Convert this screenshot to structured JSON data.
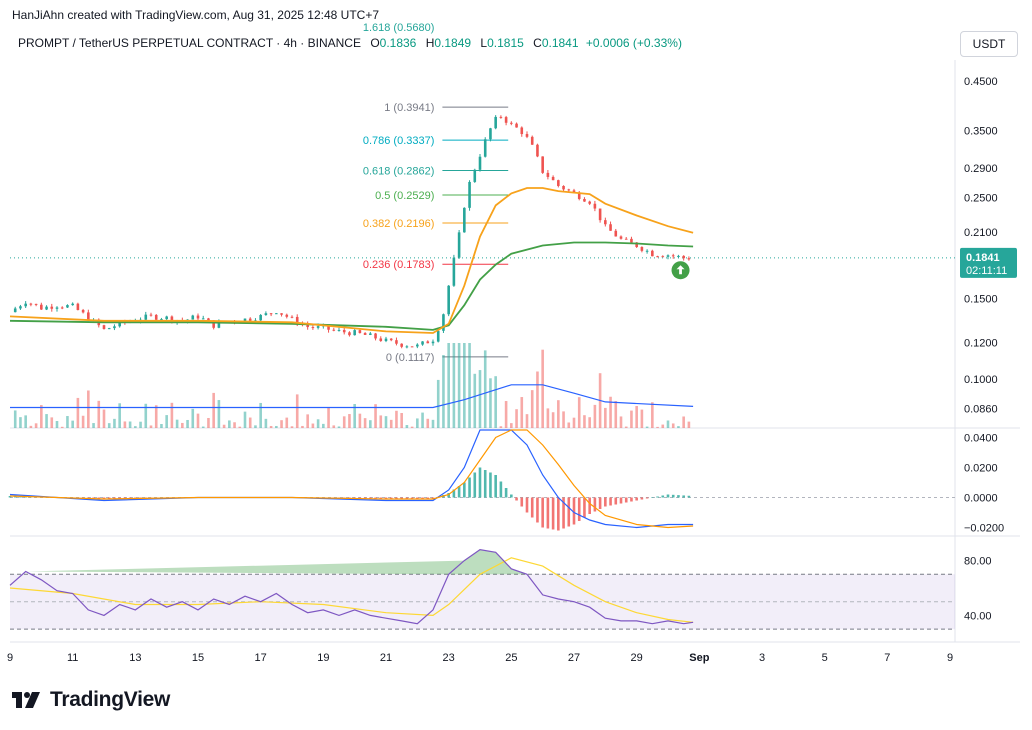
{
  "header": {
    "credit": "HanJiAhn created with TradingView.com, Aug 31, 2025 12:48 UTC+7",
    "symbol": "PROMPT / TetherUS PERPETUAL CONTRACT · 4h · BINANCE",
    "o_label": "O",
    "o_value": "0.1836",
    "h_label": "H",
    "h_value": "0.1849",
    "l_label": "L",
    "l_value": "0.1815",
    "c_label": "C",
    "c_value": "0.1841",
    "change": "+0.0006 (+0.33%)",
    "currency_button": "USDT"
  },
  "brand": {
    "name": "TradingView"
  },
  "colors": {
    "up": "#26a69a",
    "down": "#ef5350",
    "ma_fast": "#f7a21b",
    "ma_slow": "#43a047",
    "macd": "#2962ff",
    "signal": "#ff9800",
    "rsi": "#7e57c2",
    "rsi_ma": "#fdd835"
  },
  "chart_data": {
    "type": "candlestick",
    "timeframe": "4h",
    "y_axis_ticks": [
      "0.4500",
      "0.3500",
      "0.2900",
      "0.2500",
      "0.2100",
      "0.1500",
      "0.1200",
      "0.1000",
      "0.0860"
    ],
    "y_scale": "log",
    "x_axis_ticks": [
      "9",
      "11",
      "13",
      "15",
      "17",
      "19",
      "21",
      "23",
      "25",
      "27",
      "29",
      "Sep",
      "3",
      "5",
      "7",
      "9"
    ],
    "last_price": "0.1841",
    "countdown": "02:11:11",
    "fib_levels": [
      {
        "label": "1 (0.3941)",
        "value": 0.3941,
        "color": "#787b86"
      },
      {
        "label": "0.786 (0.3337)",
        "value": 0.3337,
        "color": "#00acc1"
      },
      {
        "label": "0.618 (0.2862)",
        "value": 0.2862,
        "color": "#26a69a"
      },
      {
        "label": "0.5 (0.2529)",
        "value": 0.2529,
        "color": "#4caf50"
      },
      {
        "label": "0.382 (0.2196)",
        "value": 0.2196,
        "color": "#f7a21b"
      },
      {
        "label": "0.236 (0.1783)",
        "value": 0.1783,
        "color": "#f23645"
      },
      {
        "label": "0 (0.1117)",
        "value": 0.1117,
        "color": "#787b86"
      }
    ],
    "fib_partial_label": "1.618 (0.5680)",
    "price_path": [
      [
        9,
        0.14
      ],
      [
        9.5,
        0.148
      ],
      [
        10,
        0.143
      ],
      [
        10.5,
        0.145
      ],
      [
        11,
        0.144
      ],
      [
        11.5,
        0.136
      ],
      [
        12,
        0.128
      ],
      [
        12.5,
        0.132
      ],
      [
        13,
        0.135
      ],
      [
        13.5,
        0.137
      ],
      [
        14,
        0.136
      ],
      [
        14.5,
        0.134
      ],
      [
        15,
        0.137
      ],
      [
        15.5,
        0.131
      ],
      [
        16,
        0.134
      ],
      [
        16.5,
        0.135
      ],
      [
        17,
        0.137
      ],
      [
        17.5,
        0.141
      ],
      [
        18,
        0.135
      ],
      [
        18.5,
        0.13
      ],
      [
        19,
        0.129
      ],
      [
        19.5,
        0.127
      ],
      [
        20,
        0.126
      ],
      [
        20.5,
        0.124
      ],
      [
        21,
        0.121
      ],
      [
        21.5,
        0.119
      ],
      [
        22,
        0.118
      ],
      [
        22.5,
        0.122
      ],
      [
        22.8,
        0.135
      ],
      [
        23,
        0.16
      ],
      [
        23.3,
        0.2
      ],
      [
        23.6,
        0.26
      ],
      [
        24,
        0.31
      ],
      [
        24.3,
        0.35
      ],
      [
        24.6,
        0.38
      ],
      [
        25,
        0.36
      ],
      [
        25.3,
        0.35
      ],
      [
        25.6,
        0.33
      ],
      [
        26,
        0.285
      ],
      [
        26.5,
        0.265
      ],
      [
        27,
        0.255
      ],
      [
        27.5,
        0.245
      ],
      [
        28,
        0.215
      ],
      [
        28.5,
        0.202
      ],
      [
        29,
        0.196
      ],
      [
        29.5,
        0.188
      ],
      [
        30,
        0.187
      ],
      [
        30.5,
        0.184
      ],
      [
        30.8,
        0.1841
      ]
    ],
    "ma_fast": [
      [
        9,
        0.137
      ],
      [
        12,
        0.134
      ],
      [
        15,
        0.134
      ],
      [
        18,
        0.133
      ],
      [
        21,
        0.127
      ],
      [
        22.5,
        0.126
      ],
      [
        23,
        0.132
      ],
      [
        23.5,
        0.16
      ],
      [
        24,
        0.205
      ],
      [
        24.5,
        0.24
      ],
      [
        25,
        0.255
      ],
      [
        25.5,
        0.262
      ],
      [
        26,
        0.262
      ],
      [
        26.5,
        0.258
      ],
      [
        27,
        0.256
      ],
      [
        27.5,
        0.254
      ],
      [
        28,
        0.242
      ],
      [
        29,
        0.228
      ],
      [
        30,
        0.216
      ],
      [
        30.8,
        0.209
      ]
    ],
    "ma_slow": [
      [
        9,
        0.134
      ],
      [
        12,
        0.133
      ],
      [
        15,
        0.133
      ],
      [
        18,
        0.132
      ],
      [
        21,
        0.13
      ],
      [
        22.5,
        0.128
      ],
      [
        23,
        0.131
      ],
      [
        23.5,
        0.145
      ],
      [
        24,
        0.165
      ],
      [
        24.5,
        0.178
      ],
      [
        25,
        0.188
      ],
      [
        26,
        0.196
      ],
      [
        27,
        0.199
      ],
      [
        28,
        0.199
      ],
      [
        29,
        0.198
      ],
      [
        30,
        0.196
      ],
      [
        30.8,
        0.195
      ]
    ],
    "macd_ticks": [
      "0.0400",
      "0.0200",
      "0.0000",
      "−0.0200"
    ],
    "rsi_ticks": [
      "80.00",
      "40.00"
    ],
    "arrow_signal": "up"
  }
}
